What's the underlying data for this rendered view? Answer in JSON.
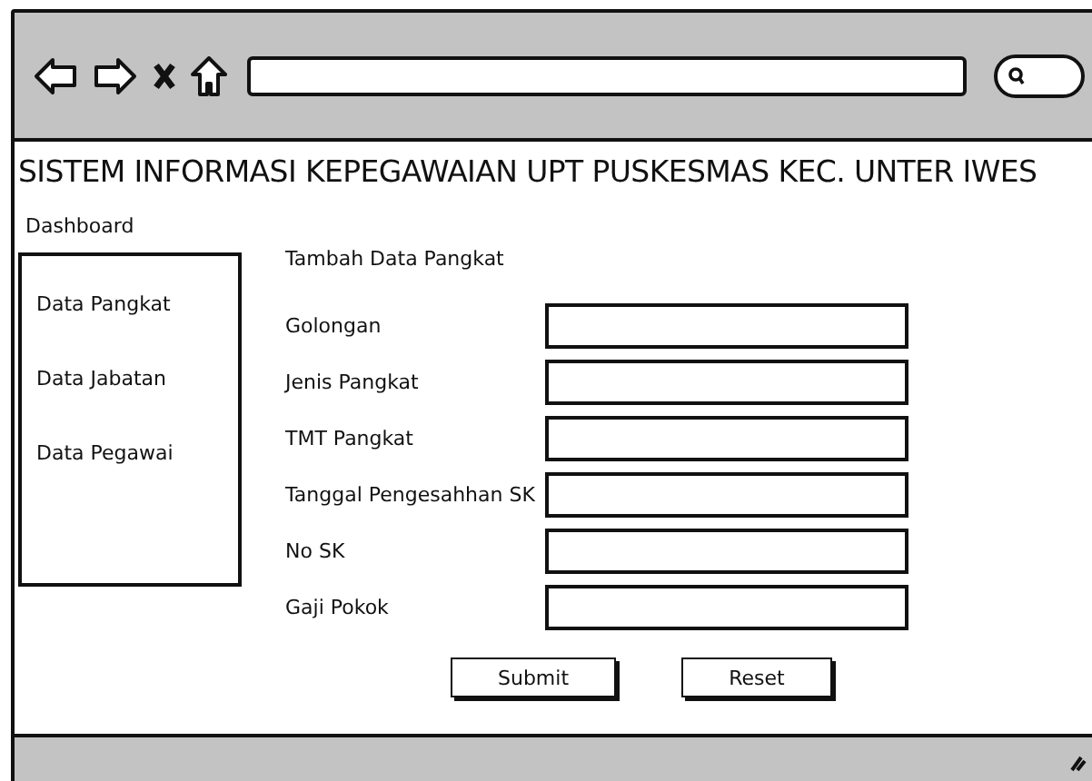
{
  "title": "SISTEM INFORMASI KEPEGAWAIAN UPT PUSKESMAS KEC. UNTER IWES",
  "breadcrumb": "Dashboard",
  "sidebar": {
    "items": [
      {
        "label": "Data Pangkat"
      },
      {
        "label": "Data Jabatan"
      },
      {
        "label": "Data Pegawai"
      }
    ]
  },
  "form": {
    "title": "Tambah Data Pangkat",
    "fields": [
      {
        "label": "Golongan"
      },
      {
        "label": "Jenis Pangkat"
      },
      {
        "label": "TMT Pangkat"
      },
      {
        "label": "Tanggal Pengesahhan SK"
      },
      {
        "label": "No SK"
      },
      {
        "label": "Gaji Pokok"
      }
    ],
    "buttons": [
      "Submit",
      "Reset"
    ]
  }
}
